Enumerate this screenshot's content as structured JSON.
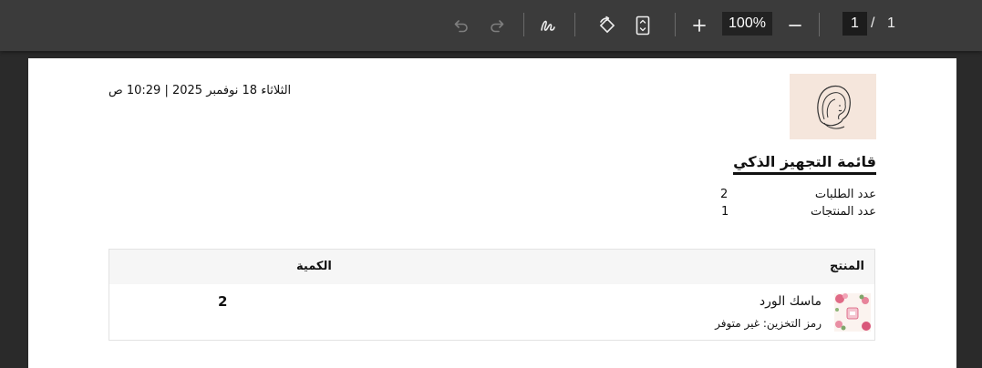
{
  "toolbar": {
    "zoom": "100%",
    "current_page": "1",
    "page_separator": "/",
    "total_pages": "1"
  },
  "document": {
    "datetime": "الثلاثاء 18 نوفمبر 2025 | 10:29 ص",
    "title": "قائمة التجهيز الذكي",
    "stats": [
      {
        "label": "عدد الطلبات",
        "value": "2"
      },
      {
        "label": "عدد المنتجات",
        "value": "1"
      }
    ],
    "table": {
      "headers": {
        "product": "المنتج",
        "quantity": "الكمية"
      },
      "rows": [
        {
          "name": "ماسك الورد",
          "sku": "رمز التخزين: غير متوفر",
          "quantity": "2"
        }
      ]
    }
  },
  "colors": {
    "toolbar_bg": "#3b3b3b",
    "viewer_bg": "#2a2a2a",
    "logo_bg": "#f5e6dc",
    "table_header_bg": "#f6f6f6"
  }
}
